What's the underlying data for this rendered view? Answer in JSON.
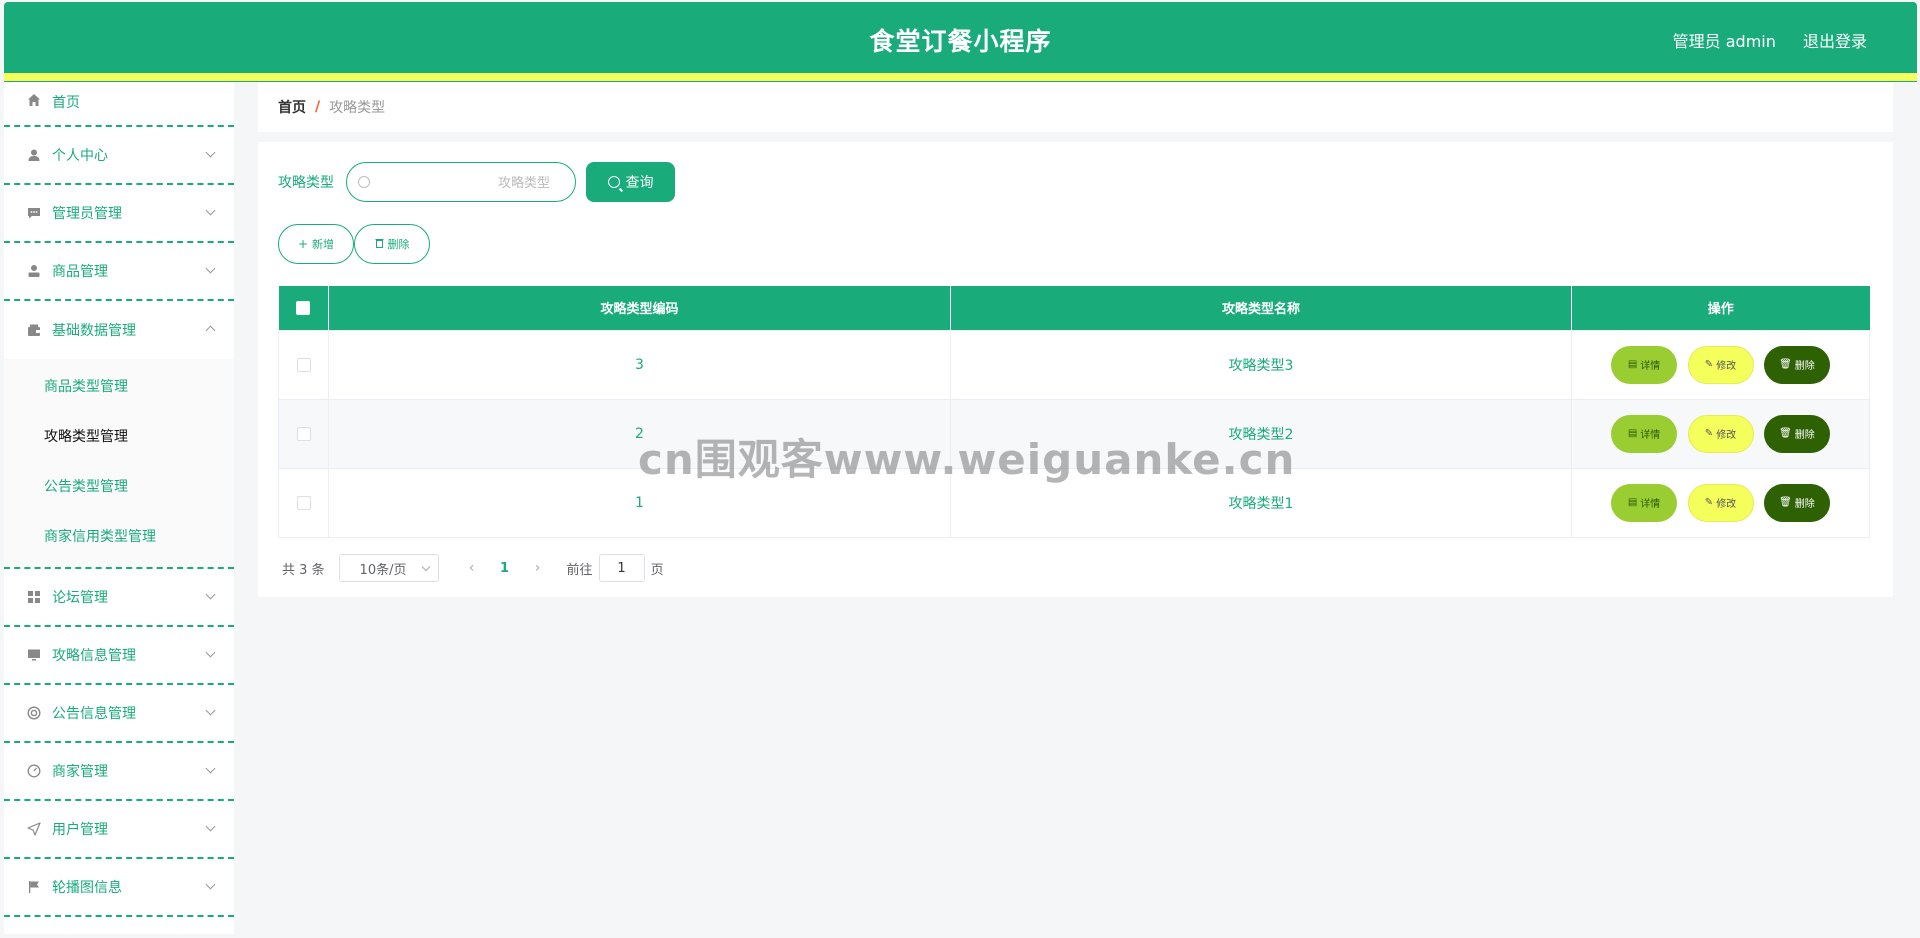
{
  "app": {
    "title": "食堂订餐小程序",
    "user_label": "管理员 admin",
    "logout_label": "退出登录"
  },
  "colors": {
    "primary": "#1aab7b",
    "accent_strip": "#f4ff5c",
    "detail_button": "#9acd32",
    "edit_button": "#f4ff5c",
    "delete_button": "#2e6103",
    "breadcrumb_separator": "#ff5a1f"
  },
  "sidebar": {
    "items": [
      {
        "label": "首页",
        "icon": "home-icon"
      },
      {
        "label": "个人中心",
        "icon": "user-icon"
      },
      {
        "label": "管理员管理",
        "icon": "chat-icon"
      },
      {
        "label": "商品管理",
        "icon": "person-icon"
      },
      {
        "label": "基础数据管理",
        "icon": "wallet-icon",
        "children": [
          {
            "label": "商品类型管理"
          },
          {
            "label": "攻略类型管理"
          },
          {
            "label": "公告类型管理"
          },
          {
            "label": "商家信用类型管理"
          }
        ]
      },
      {
        "label": "论坛管理",
        "icon": "grid-icon"
      },
      {
        "label": "攻略信息管理",
        "icon": "monitor-icon"
      },
      {
        "label": "公告信息管理",
        "icon": "lifebuoy-icon"
      },
      {
        "label": "商家管理",
        "icon": "dashboard-icon"
      },
      {
        "label": "用户管理",
        "icon": "send-icon"
      },
      {
        "label": "轮播图信息",
        "icon": "flag-icon"
      }
    ]
  },
  "breadcrumb": {
    "home": "首页",
    "separator": "/",
    "current": "攻略类型"
  },
  "search": {
    "label": "攻略类型",
    "placeholder": "攻略类型",
    "button": "查询"
  },
  "actions": {
    "add": "新增",
    "delete": "删除"
  },
  "table": {
    "columns": [
      "攻略类型编码",
      "攻略类型名称",
      "操作"
    ],
    "rows": [
      {
        "code": "3",
        "name": "攻略类型3"
      },
      {
        "code": "2",
        "name": "攻略类型2"
      },
      {
        "code": "1",
        "name": "攻略类型1"
      }
    ],
    "row_actions": {
      "detail": "详情",
      "edit": "修改",
      "delete": "删除"
    }
  },
  "pagination": {
    "total_text": "共 3 条",
    "page_size": "10条/页",
    "current_page": "1",
    "goto_prefix": "前往",
    "goto_value": "1",
    "goto_suffix": "页"
  },
  "watermark": "cn围观客www.weiguanke.cn"
}
